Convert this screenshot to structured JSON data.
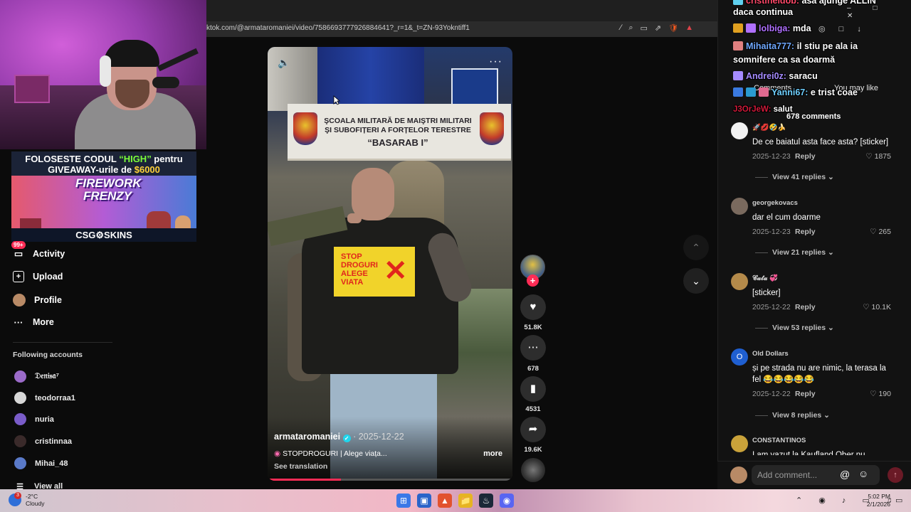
{
  "browser": {
    "url": "ktok.com/@armataromaniei/video/7586693777926884641?_r=1&_t=ZN-93Yokntiff1",
    "url_icons": [
      "∕",
      "⌕",
      "▭",
      "⇗",
      "🛡",
      "▲"
    ],
    "window_controls": "– □ ✕",
    "right_icons": "◎ □ ↓"
  },
  "promo": {
    "line1_pre": "FOLOSESTE CODUL ",
    "line1_code": "“HIGH”",
    "line1_post": " pentru",
    "line2_pre": "GIVEAWAY-urile de ",
    "line2_amount": "$6000",
    "art_title": "FIREWORK FRENZY",
    "brand": "CSG⚙SKINS"
  },
  "nav": {
    "badge": "99+",
    "items": [
      {
        "label": "Activity",
        "icon": "inbox-icon"
      },
      {
        "label": "Upload",
        "icon": "upload-icon"
      },
      {
        "label": "Profile",
        "icon": "avatar"
      },
      {
        "label": "More",
        "icon": "more-icon"
      }
    ],
    "following_title": "Following accounts",
    "following": [
      {
        "name": "𝔇𝔢𝔫𝔦𝔰𝔞⁷",
        "color": "#9b6bc9"
      },
      {
        "name": "teodorraa1",
        "color": "#d7d7d7"
      },
      {
        "name": "nuria",
        "color": "#7a5cc9"
      },
      {
        "name": "cristinnaa",
        "color": "#3a2a2a"
      },
      {
        "name": "Mihai_48",
        "color": "#5a7ac9"
      }
    ],
    "view_all": "View all"
  },
  "video": {
    "sign_line1": "ŞCOALA MILITARĂ DE MAIŞTRI MILITARI",
    "sign_line2": "ŞI SUBOFIȚERI A FORȚELOR TERESTRE",
    "sign_line3": "“BASARAB I”",
    "shirt_text": "STOP DROGURI ALEGE VIATA",
    "author": "armataromaniei",
    "date": "· 2025-12-22",
    "description": "STOPDROGURI | Alege viața...",
    "more": "more",
    "translate": "See translation",
    "progress": 0.3
  },
  "actions": {
    "likes": "51.8K",
    "comments": "678",
    "saves": "4531",
    "shares": "19.6K"
  },
  "panel": {
    "tab_comments": "Comments",
    "tab_you_may_like": "You may like",
    "comments_count": "678 comments"
  },
  "comments": [
    {
      "user": "🚀💋🤣🍌",
      "text": "De ce baiatul asta face asta? [sticker]",
      "date": "2025-12-23",
      "reply": "Reply",
      "likes": "♡ 1875",
      "views": "View 41 replies ⌄",
      "avatar_color": "#f2f2f2"
    },
    {
      "user": "georgekovacs",
      "text": "dar el cum doarme",
      "date": "2025-12-23",
      "reply": "Reply",
      "likes": "♡ 265",
      "views": "View 21 replies ⌄",
      "avatar_color": "#7a6a5e"
    },
    {
      "user": "𝓒𝓪𝓽𝓪 💞",
      "text": "[sticker]",
      "date": "2025-12-22",
      "reply": "Reply",
      "likes": "♡ 10.1K",
      "views": "View 53 replies ⌄",
      "avatar_color": "#b48a4a"
    },
    {
      "user": "Old Dollars",
      "text": "și pe strada nu are nimic, la terasa la fel 😂😂😂😂😂",
      "date": "2025-12-22",
      "reply": "Reply",
      "likes": "♡ 190",
      "views": "View 8 replies ⌄",
      "avatar_color": "#1f5fd1",
      "avatar_letter": "O"
    },
    {
      "user": "CONSTANTINOS",
      "text": "I am vazut la Kaufland Ober nu",
      "avatar_color": "#c9a23a"
    }
  ],
  "composer": {
    "placeholder": "Add comment...",
    "at": "@",
    "emoji": "☺",
    "send": "↑"
  },
  "chat": [
    {
      "user": "cristineldob:",
      "msg": " asa ajunge ALLIN",
      "user_color": "#ff4a6a",
      "badge": "#5fd0f0"
    },
    {
      "user": "",
      "msg": "daca continua",
      "user_color": "#fff",
      "badge": ""
    },
    {
      "user": "lolbiga:",
      "msg": " mda",
      "user_color": "#b070ff",
      "badge": "#e0a020"
    },
    {
      "user": "Mihaita777:",
      "msg": " il stiu pe ala ia",
      "user_color": "#6fa8ff",
      "badge": "#e08080"
    },
    {
      "user": "",
      "msg": "somnifere ca sa doarmă",
      "user_color": "#fff",
      "badge": ""
    },
    {
      "user": "Andrei0z:",
      "msg": " saracu",
      "user_color": "#a58bff",
      "badge": "#a58bff"
    },
    {
      "user": "Yanni67:",
      "msg": " e trist coae",
      "user_color": "#6fd0ff",
      "badge": "#3a7ae0"
    },
    {
      "user": "J3OrJeW:",
      "msg": " salut",
      "user_color": "#d01a3a",
      "badge": ""
    }
  ],
  "taskbar": {
    "temp": "-2°C",
    "condition": "Cloudy",
    "weather_badge": "3",
    "apps": [
      "⊞",
      "▣",
      "▲",
      "📁",
      "♨",
      "◉"
    ],
    "tray": "⌃ ◉ ♪ ▭ ♫",
    "time": "5:02 PM",
    "date": "2/1/2026",
    "notif": "▭"
  }
}
